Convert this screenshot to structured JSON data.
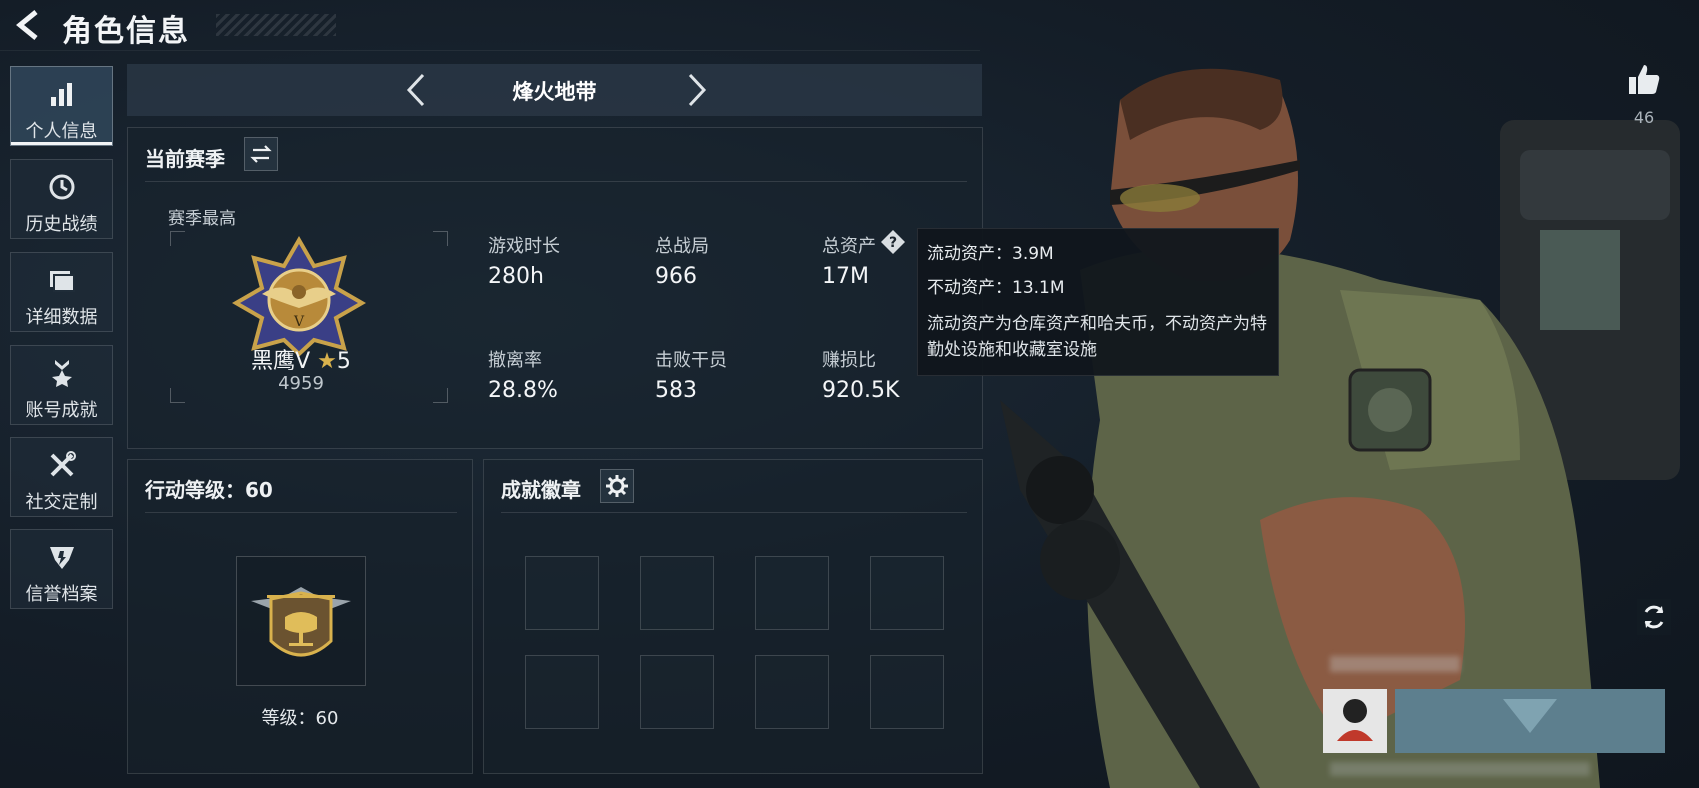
{
  "header": {
    "title": "角色信息"
  },
  "sidebar": {
    "items": [
      {
        "label": "个人信息",
        "icon": "bar-chart-icon"
      },
      {
        "label": "历史战绩",
        "icon": "history-clock-icon"
      },
      {
        "label": "详细数据",
        "icon": "folder-icon"
      },
      {
        "label": "账号成就",
        "icon": "achievement-medal-icon"
      },
      {
        "label": "社交定制",
        "icon": "tools-icon"
      },
      {
        "label": "信誉档案",
        "icon": "shield-icon"
      }
    ]
  },
  "map_selector": {
    "name": "烽火地带"
  },
  "season_panel": {
    "title": "当前赛季",
    "best_label": "赛季最高",
    "rank_name": "黑鹰Ⅴ",
    "rank_stars": "5",
    "rank_score": "4959",
    "stats": [
      {
        "label": "游戏时长",
        "value": "280h"
      },
      {
        "label": "总战局",
        "value": "966"
      },
      {
        "label": "总资产",
        "value": "17M"
      },
      {
        "label": "撤离率",
        "value": "28.8%"
      },
      {
        "label": "击败干员",
        "value": "583"
      },
      {
        "label": "赚损比",
        "value": "920.5K"
      }
    ]
  },
  "tooltip": {
    "liquid": "流动资产：3.9M",
    "fixed": "不动资产：13.1M",
    "description": "流动资产为仓库资产和哈夫币，不动资产为特勤处设施和收藏室设施"
  },
  "action_panel": {
    "title": "行动等级：60",
    "level_text": "等级：60"
  },
  "badge_panel": {
    "title": "成就徽章"
  },
  "likes": {
    "count": "46"
  },
  "colors": {
    "accent_gold": "#c9a24a",
    "panel_bg": "#18222c",
    "tooltip_bg": "#10161c"
  }
}
